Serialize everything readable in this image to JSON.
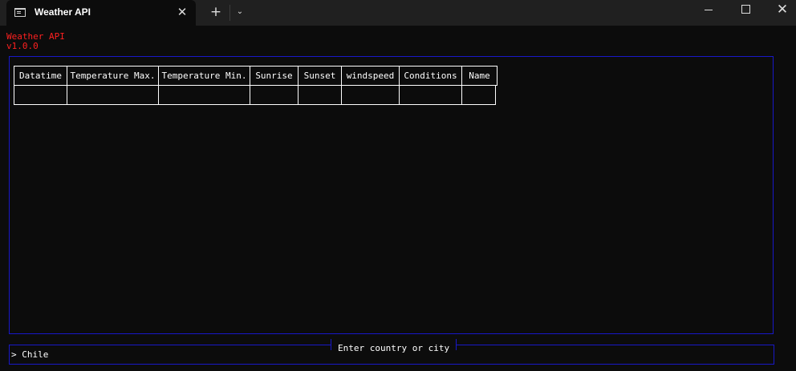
{
  "window": {
    "tab_title": "Weather API",
    "tab_close": "✕",
    "new_tab": "+",
    "dropdown": "⌄",
    "close": "✕"
  },
  "app": {
    "name": "Weather API",
    "version": "v1.0.0"
  },
  "table": {
    "columns": [
      "Datatime",
      "Temperature Max.",
      "Temperature Min.",
      "Sunrise",
      "Sunset",
      "windspeed",
      "Conditions",
      "Name"
    ],
    "rows": [
      [
        "",
        "",
        "",
        "",
        "",
        "",
        "",
        ""
      ]
    ]
  },
  "input": {
    "title": "Enter country or city",
    "prompt": ">",
    "value": "Chile"
  },
  "colors": {
    "background": "#0c0c0c",
    "titlebar": "#202020",
    "accent_red": "#ff2020",
    "border_blue": "#1818c8",
    "text": "#ffffff"
  }
}
